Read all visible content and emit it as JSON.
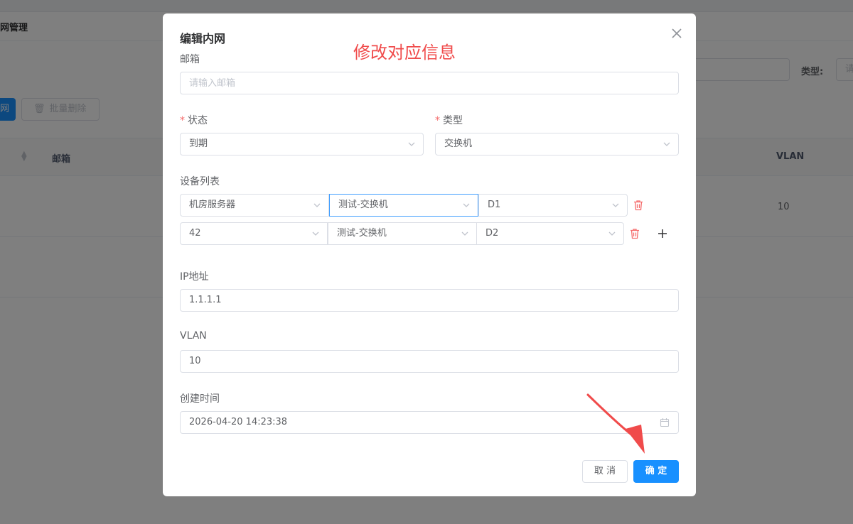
{
  "background": {
    "breadcrumb": "网管理",
    "type_label": "类型:",
    "type_input_placeholder": "请",
    "add_button": "网",
    "batch_delete_button": "批量删除",
    "table_headers": {
      "email": "邮箱",
      "vlan": "VLAN"
    },
    "row_vlan": "10"
  },
  "dialog": {
    "title": "编辑内网",
    "annotation": "修改对应信息",
    "email": {
      "label": "邮箱",
      "placeholder": "请输入邮箱",
      "value": ""
    },
    "status": {
      "label": "状态",
      "required_mark": "*",
      "value": "到期"
    },
    "type": {
      "label": "类型",
      "required_mark": "*",
      "value": "交换机"
    },
    "device_list": {
      "label": "设备列表",
      "rows": [
        {
          "room": "机房服务器",
          "device": "测试-交换机",
          "port": "D1"
        },
        {
          "room": "42",
          "device": "测试-交换机",
          "port": "D2"
        }
      ]
    },
    "ip": {
      "label": "IP地址",
      "value": "1.1.1.1"
    },
    "vlan": {
      "label": "VLAN",
      "value": "10"
    },
    "created": {
      "label": "创建时间",
      "value": "2026-04-20 14:23:38"
    },
    "buttons": {
      "cancel": "取 消",
      "confirm": "确 定"
    }
  },
  "colors": {
    "primary": "#1890ff",
    "danger": "#f56c6c",
    "annotation": "#f04b4b"
  }
}
